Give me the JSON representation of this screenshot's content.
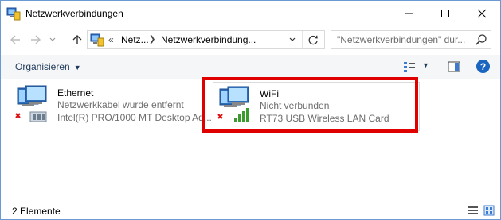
{
  "window": {
    "title": "Netzwerkverbindungen",
    "icon": "network-connections-icon"
  },
  "nav": {
    "back_icon": "arrow-left-icon",
    "forward_icon": "arrow-right-icon",
    "up_icon": "arrow-up-icon",
    "address": {
      "prefix": "«",
      "crumb1": "Netz...",
      "crumb2": "Netzwerkverbindung..."
    },
    "search_placeholder": "\"Netzwerkverbindungen\" dur..."
  },
  "commandbar": {
    "organize_label": "Organisieren",
    "help_label": "?"
  },
  "items": [
    {
      "name": "Ethernet",
      "status": "Netzwerkkabel wurde entfernt",
      "device": "Intel(R) PRO/1000 MT Desktop Ad...",
      "icon": "ethernet-adapter-icon"
    },
    {
      "name": "WiFi",
      "status": "Nicht verbunden",
      "device": "RT73 USB Wireless LAN Card",
      "icon": "wireless-adapter-icon"
    }
  ],
  "statusbar": {
    "count": "2 Elemente"
  },
  "colors": {
    "highlight": "#e00000",
    "accent": "#1a65c0",
    "secondary_text": "#6d6d6d"
  }
}
